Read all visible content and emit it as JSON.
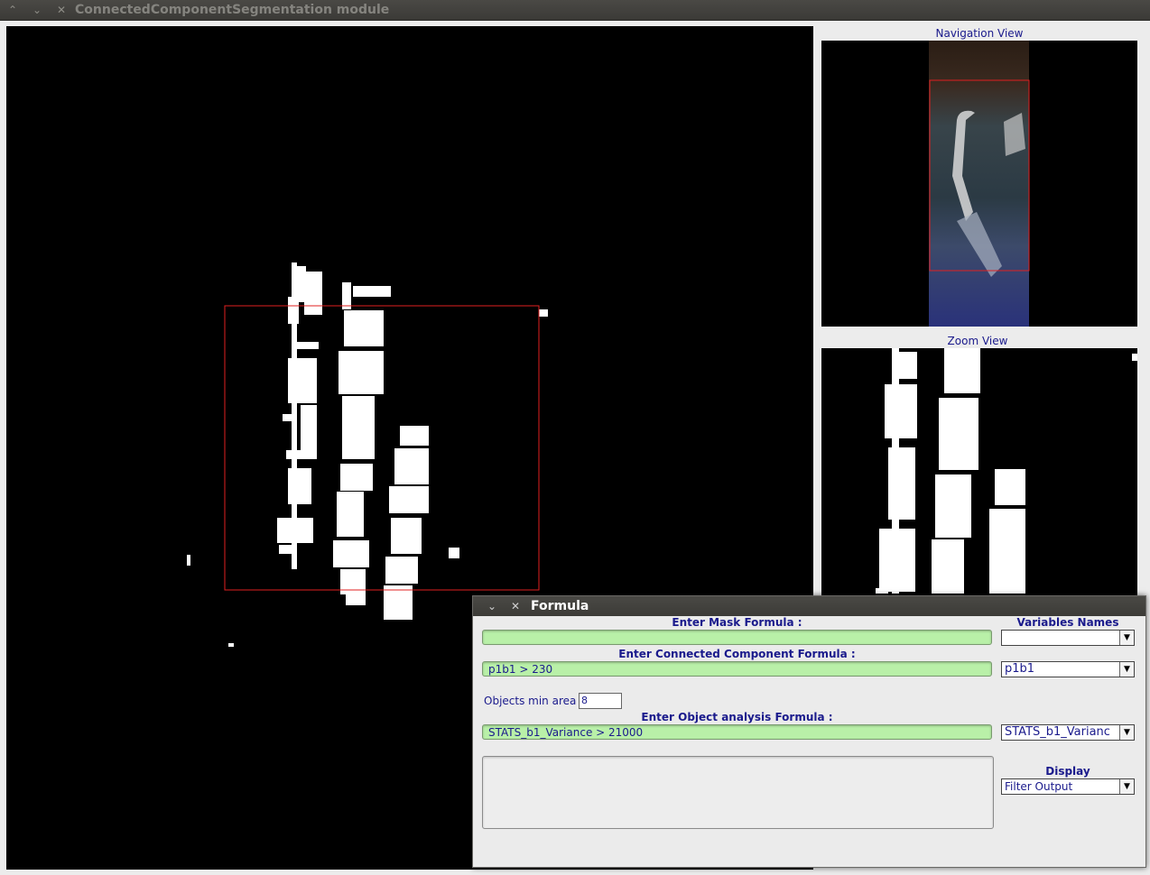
{
  "window": {
    "title": "ConnectedComponentSegmentation module"
  },
  "views": {
    "navigation_label": "Navigation View",
    "zoom_label": "Zoom View"
  },
  "dialog": {
    "title": "Formula",
    "mask_label": "Enter Mask Formula :",
    "mask_value": "",
    "variables_label": "Variables Names",
    "variables_selected": "",
    "cc_label": "Enter Connected Component Formula :",
    "cc_value": "p1b1 > 230",
    "cc_variable_selected": "p1b1",
    "min_area_label": "Objects min area :",
    "min_area_value": "8",
    "obj_label": "Enter Object analysis Formula :",
    "obj_value": "STATS_b1_Variance > 21000",
    "obj_variable_selected": "STATS_b1_Varianc",
    "display_label": "Display",
    "display_selected": "Filter Output",
    "output_text": ""
  },
  "colors": {
    "accent_text": "#1a1a8c",
    "formula_bg": "#b9f0a8",
    "roi_rect": "#e02020",
    "titlebar": "#3c3b37"
  },
  "icons": [
    "minimize-icon",
    "maximize-icon",
    "close-icon",
    "dropdown-arrow-icon"
  ]
}
